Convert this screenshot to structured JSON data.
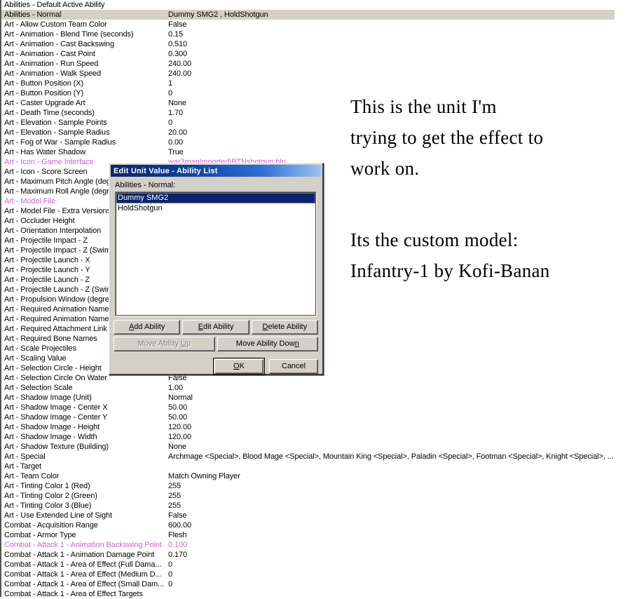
{
  "property_grid": {
    "value_column_x": 238,
    "rows": [
      {
        "name": "Abilities - Default Active Ability",
        "value": "",
        "style": "normal"
      },
      {
        "name": "Abilities - Normal",
        "value": "Dummy SMG2 , HoldShotgun",
        "style": "selected"
      },
      {
        "name": "Art - Allow Custom Team Color",
        "value": "False",
        "style": "normal"
      },
      {
        "name": "Art - Animation - Blend Time (seconds)",
        "value": "0.15",
        "style": "normal"
      },
      {
        "name": "Art - Animation - Cast Backswing",
        "value": "0.510",
        "style": "normal"
      },
      {
        "name": "Art - Animation - Cast Point",
        "value": "0.300",
        "style": "normal"
      },
      {
        "name": "Art - Animation - Run Speed",
        "value": "240.00",
        "style": "normal"
      },
      {
        "name": "Art - Animation - Walk Speed",
        "value": "240.00",
        "style": "normal"
      },
      {
        "name": "Art - Button Position (X)",
        "value": "1",
        "style": "normal"
      },
      {
        "name": "Art - Button Position (Y)",
        "value": "0",
        "style": "normal"
      },
      {
        "name": "Art - Caster Upgrade Art",
        "value": "None",
        "style": "normal"
      },
      {
        "name": "Art - Death Time (seconds)",
        "value": "1.70",
        "style": "normal"
      },
      {
        "name": "Art - Elevation - Sample Points",
        "value": "0",
        "style": "normal"
      },
      {
        "name": "Art - Elevation - Sample Radius",
        "value": "20.00",
        "style": "normal"
      },
      {
        "name": "Art - Fog of War - Sample Radius",
        "value": "0.00",
        "style": "normal"
      },
      {
        "name": "Art - Has Water Shadow",
        "value": "True",
        "style": "normal"
      },
      {
        "name": "Art - Icon - Game Interface",
        "value": "war3mapImported\\BTNshotgun.blp",
        "style": "magenta"
      },
      {
        "name": "Art - Icon - Score Screen",
        "value": "",
        "style": "normal"
      },
      {
        "name": "Art - Maximum Pitch Angle (degre",
        "value": "",
        "style": "normal"
      },
      {
        "name": "Art - Maximum Roll Angle (degree",
        "value": "",
        "style": "normal"
      },
      {
        "name": "Art - Model File",
        "value": "",
        "style": "magenta"
      },
      {
        "name": "Art - Model File - Extra Versions",
        "value": "",
        "style": "normal"
      },
      {
        "name": "Art - Occluder Height",
        "value": "",
        "style": "normal"
      },
      {
        "name": "Art - Orientation Interpolation",
        "value": "",
        "style": "normal"
      },
      {
        "name": "Art - Projectile Impact - Z",
        "value": "",
        "style": "normal"
      },
      {
        "name": "Art - Projectile Impact - Z (Swimm",
        "value": "",
        "style": "normal"
      },
      {
        "name": "Art - Projectile Launch - X",
        "value": "",
        "style": "normal"
      },
      {
        "name": "Art - Projectile Launch - Y",
        "value": "",
        "style": "normal"
      },
      {
        "name": "Art - Projectile Launch - Z",
        "value": "",
        "style": "normal"
      },
      {
        "name": "Art - Projectile Launch - Z (Swimm",
        "value": "",
        "style": "normal"
      },
      {
        "name": "Art - Propulsion Window (degree:",
        "value": "",
        "style": "normal"
      },
      {
        "name": "Art - Required Animation Names",
        "value": "",
        "style": "normal"
      },
      {
        "name": "Art - Required Animation Names",
        "value": "",
        "style": "normal"
      },
      {
        "name": "Art - Required Attachment Link N",
        "value": "",
        "style": "normal"
      },
      {
        "name": "Art - Required Bone Names",
        "value": "",
        "style": "normal"
      },
      {
        "name": "Art - Scale Projectiles",
        "value": "",
        "style": "normal"
      },
      {
        "name": "Art - Scaling Value",
        "value": "",
        "style": "normal"
      },
      {
        "name": "Art - Selection Circle - Height",
        "value": "",
        "style": "normal"
      },
      {
        "name": "Art - Selection Circle On Water",
        "value": "False",
        "style": "normal"
      },
      {
        "name": "Art - Selection Scale",
        "value": "1.00",
        "style": "normal"
      },
      {
        "name": "Art - Shadow Image (Unit)",
        "value": "Normal",
        "style": "normal"
      },
      {
        "name": "Art - Shadow Image - Center X",
        "value": "50.00",
        "style": "normal"
      },
      {
        "name": "Art - Shadow Image - Center Y",
        "value": "50.00",
        "style": "normal"
      },
      {
        "name": "Art - Shadow Image - Height",
        "value": "120.00",
        "style": "normal"
      },
      {
        "name": "Art - Shadow Image - Width",
        "value": "120.00",
        "style": "normal"
      },
      {
        "name": "Art - Shadow Texture (Building)",
        "value": "None",
        "style": "normal"
      },
      {
        "name": "Art - Special",
        "value": "Archmage <Special>, Blood Mage <Special>, Mountain King <Special>, Paladin <Special>, Footman <Special>, Knight <Special>, ...",
        "style": "normal"
      },
      {
        "name": "Art - Target",
        "value": "",
        "style": "normal"
      },
      {
        "name": "Art - Team Color",
        "value": "Match Owning Player",
        "style": "normal"
      },
      {
        "name": "Art - Tinting Color 1 (Red)",
        "value": "255",
        "style": "normal"
      },
      {
        "name": "Art - Tinting Color 2 (Green)",
        "value": "255",
        "style": "normal"
      },
      {
        "name": "Art - Tinting Color 3 (Blue)",
        "value": "255",
        "style": "normal"
      },
      {
        "name": "Art - Use Extended Line of Sight",
        "value": "False",
        "style": "normal"
      },
      {
        "name": "Combat - Acquisition Range",
        "value": "600.00",
        "style": "normal"
      },
      {
        "name": "Combat - Armor Type",
        "value": "Flesh",
        "style": "normal"
      },
      {
        "name": "Combat - Attack 1 - Animation Backswing Point",
        "value": "0.100",
        "style": "magenta"
      },
      {
        "name": "Combat - Attack 1 - Animation Damage Point",
        "value": "0.170",
        "style": "normal"
      },
      {
        "name": "Combat - Attack 1 - Area of Effect (Full Dama...",
        "value": "0",
        "style": "normal"
      },
      {
        "name": "Combat - Attack 1 - Area of Effect (Medium D...",
        "value": "0",
        "style": "normal"
      },
      {
        "name": "Combat - Attack 1 - Area of Effect (Small Dam...",
        "value": "0",
        "style": "normal"
      },
      {
        "name": "Combat - Attack 1 - Area of Effect Targets",
        "value": "",
        "style": "normal"
      }
    ]
  },
  "annotations": {
    "line1": "This is the unit I'm",
    "line2": "trying to get the effect to",
    "line3": "work on.",
    "line4": "Its the custom model:",
    "line5": "Infantry-1 by Kofi-Banan"
  },
  "dialog": {
    "title": "Edit Unit Value - Ability List",
    "list_label": "Abilities - Normal:",
    "list_items": [
      {
        "label": "Dummy SMG2",
        "selected": true
      },
      {
        "label": "HoldShotgun",
        "selected": false
      }
    ],
    "buttons": {
      "add_ability": "Add Ability",
      "add_ability_accesskey": "A",
      "edit_ability": "Edit Ability",
      "edit_ability_accesskey": "E",
      "delete_ability": "Delete Ability",
      "delete_ability_accesskey": "D",
      "move_up": "Move Ability Up",
      "move_up_accesskey": "U",
      "move_up_disabled": true,
      "move_down": "Move Ability Down",
      "move_down_accesskey": "n",
      "ok": "OK",
      "ok_accesskey": "O",
      "cancel": "Cancel"
    }
  },
  "colors": {
    "dialog_face": "#d4d0c8",
    "selected_row": "#d4d0c8",
    "magenta_text": "#cc66cc",
    "list_selection": "#0a246a",
    "titlebar_start": "#0a246a",
    "titlebar_end": "#9ac3f0"
  }
}
